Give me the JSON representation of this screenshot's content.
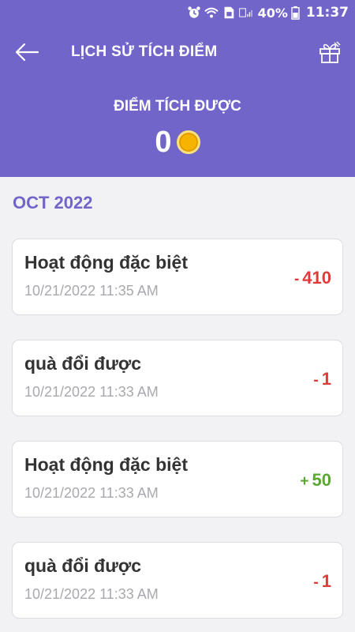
{
  "status_bar": {
    "battery_percent": "40%",
    "time": "11:37",
    "icons": [
      "alarm-icon",
      "wifi-icon",
      "sim-icon",
      "signal-icon",
      "battery-icon"
    ]
  },
  "header": {
    "title": "LỊCH SỬ TÍCH ĐIỂM",
    "points_label": "ĐIỂM TÍCH ĐƯỢC",
    "points_value": "0",
    "back_icon": "arrow-left-icon",
    "gift_icon": "gift-icon",
    "coin_icon": "coin-icon"
  },
  "colors": {
    "header_bg": "#7165c9",
    "negative": "#e03a3a",
    "positive": "#5aa832",
    "coin": "#f6b400"
  },
  "history": {
    "month": "OCT 2022",
    "items": [
      {
        "title": "Hoạt động đặc biệt",
        "time": "10/21/2022 11:35 AM",
        "sign": "-",
        "amount": "410",
        "type": "negative"
      },
      {
        "title": "quà đổi được",
        "time": "10/21/2022 11:33 AM",
        "sign": "-",
        "amount": "1",
        "type": "negative"
      },
      {
        "title": "Hoạt động đặc biệt",
        "time": "10/21/2022 11:33 AM",
        "sign": "+",
        "amount": "50",
        "type": "positive"
      },
      {
        "title": "quà đổi được",
        "time": "10/21/2022 11:33 AM",
        "sign": "-",
        "amount": "1",
        "type": "negative"
      }
    ]
  }
}
